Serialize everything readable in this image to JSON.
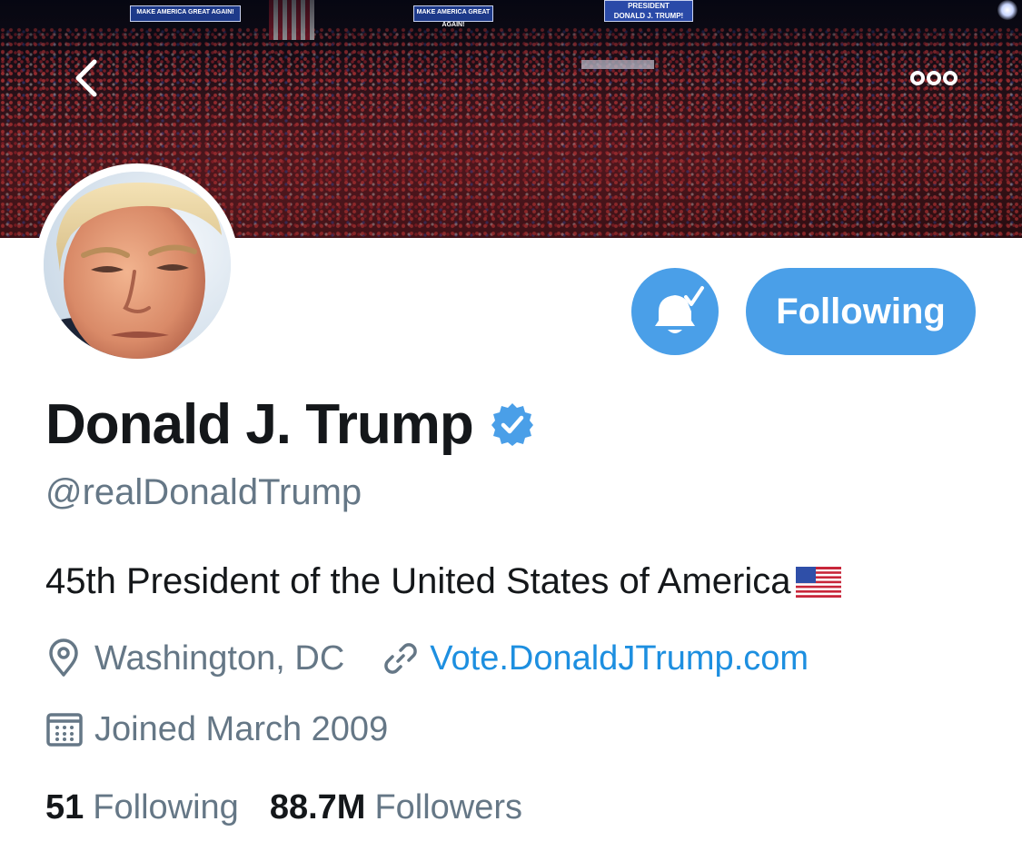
{
  "banner": {
    "sign_left": "MAKE AMERICA GREAT AGAIN!",
    "sign_center": "MAKE AMERICA GREAT AGAIN!",
    "sign_right_top": "PRESIDENT",
    "sign_right_bottom": "DONALD J. TRUMP!"
  },
  "header": {
    "back_icon": "chevron-left-icon",
    "more_icon": "more-horizontal-icon"
  },
  "profile": {
    "name": "Donald J. Trump",
    "verified_icon": "verified-badge-icon",
    "handle": "@realDonaldTrump",
    "bio": "45th President of the United States of America",
    "bio_emoji": "us-flag-emoji",
    "location": "Washington, DC",
    "website": "Vote.DonaldJTrump.com",
    "joined": "Joined March 2009"
  },
  "actions": {
    "notifications_icon": "bell-check-icon",
    "follow_label": "Following"
  },
  "stats": {
    "following_count": "51",
    "following_label": "Following",
    "followers_count": "88.7M",
    "followers_label": "Followers"
  },
  "colors": {
    "accent": "#4a9fe8",
    "link": "#1d8fe0",
    "secondary_text": "#657786",
    "primary_text": "#14171a"
  }
}
